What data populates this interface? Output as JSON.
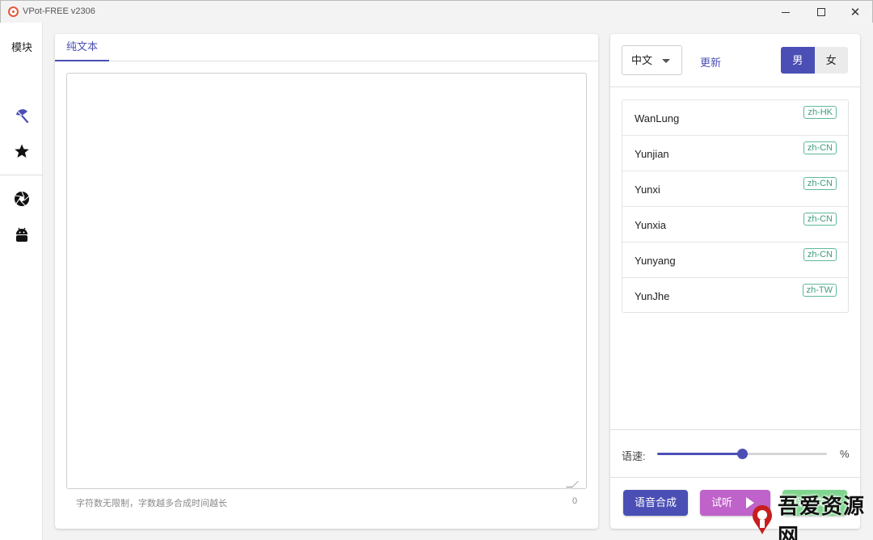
{
  "window": {
    "title": "VPot-FREE v2306"
  },
  "sidebar": {
    "title": "模块",
    "items": [
      {
        "icon": "umbrella-icon"
      },
      {
        "icon": "star-icon"
      },
      {
        "icon": "aperture-icon"
      },
      {
        "icon": "android-icon"
      }
    ]
  },
  "editor": {
    "tab_label": "纯文本",
    "text_value": "",
    "hint": "字符数无限制，字数越多合成时间越长",
    "char_count": "0"
  },
  "voice_panel": {
    "language": "中文",
    "refresh_label": "更新",
    "gender": {
      "male": "男",
      "female": "女",
      "selected": "male"
    },
    "voices": [
      {
        "name": "WanLung",
        "locale": "zh-HK"
      },
      {
        "name": "Yunjian",
        "locale": "zh-CN"
      },
      {
        "name": "Yunxi",
        "locale": "zh-CN"
      },
      {
        "name": "Yunxia",
        "locale": "zh-CN"
      },
      {
        "name": "Yunyang",
        "locale": "zh-CN"
      },
      {
        "name": "YunJhe",
        "locale": "zh-TW"
      }
    ],
    "speed": {
      "label": "语速:",
      "unit": "%",
      "fraction": 0.5
    },
    "actions": {
      "synthesize": "语音合成",
      "preview": "试听",
      "save": "保存文件"
    }
  },
  "colors": {
    "accent": "#4b4fb5",
    "preview": "#bf62c9",
    "save": "#7fd58e",
    "badge": "#3d9c7c"
  },
  "watermark": {
    "text": "吾爱资源网"
  }
}
